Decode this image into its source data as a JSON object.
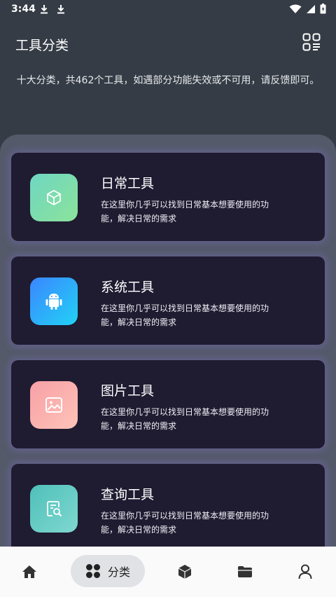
{
  "status": {
    "time": "3:44"
  },
  "header": {
    "title": "工具分类"
  },
  "subtitle": "十大分类，共462个工具，如遇部分功能失效或不可用，请反馈即可。",
  "cards": [
    {
      "title": "日常工具",
      "desc": "在这里你几乎可以找到日常基本想要使用的功能，解决日常的需求",
      "icon": "cube-icon",
      "gradient": [
        "#6fd6c2",
        "#8be39a"
      ]
    },
    {
      "title": "系统工具",
      "desc": "在这里你几乎可以找到日常基本想要使用的功能，解决日常的需求",
      "icon": "android-icon",
      "gradient": [
        "#3b86ff",
        "#21d2f5"
      ]
    },
    {
      "title": "图片工具",
      "desc": "在这里你几乎可以找到日常基本想要使用的功能，解决日常的需求",
      "icon": "image-icon",
      "gradient": [
        "#f7a0a6",
        "#ffc3b8"
      ]
    },
    {
      "title": "查询工具",
      "desc": "在这里你几乎可以找到日常基本想要使用的功能，解决日常的需求",
      "icon": "search-doc-icon",
      "gradient": [
        "#4fc0b9",
        "#7fd8d0"
      ]
    }
  ],
  "nav": {
    "active_label": "分类",
    "items": [
      "home-icon",
      "category-icon",
      "box-icon",
      "folder-icon",
      "profile-icon"
    ]
  }
}
